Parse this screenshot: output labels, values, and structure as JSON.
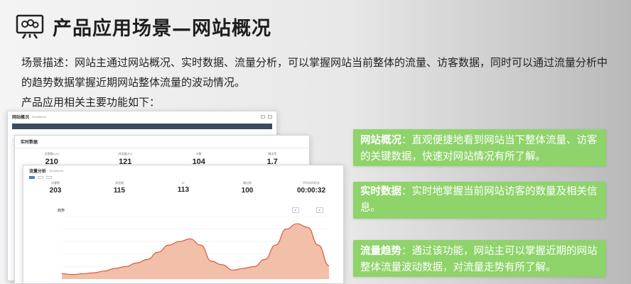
{
  "header": {
    "icon": "presentation-board-icon",
    "title": "产品应用场景—网站概况"
  },
  "description": {
    "text": "场景描述：网站主通过网站概况、实时数据、流量分析，可以掌握网站当前整体的流量、访客数据，同时可以通过流量分析中的趋势数据掌握近期网站整体流量的波动情况。",
    "intro": "产品应用相关主要功能如下："
  },
  "screens": {
    "overview": {
      "title": "网站概况",
      "date": "2016/05/24"
    },
    "realtime": {
      "title": "实时数据",
      "metrics": [
        {
          "label": "访客数(UV)",
          "value": "210"
        },
        {
          "label": "浏览量(PV)",
          "value": "121"
        },
        {
          "label": "IP数",
          "value": "104"
        },
        {
          "label": "跳出率",
          "value": "1.7"
        }
      ]
    },
    "traffic": {
      "title": "流量分析",
      "date": "2016/05/24",
      "metrics": [
        {
          "label": "访客数",
          "value": "203"
        },
        {
          "label": "浏览量",
          "value": "115"
        },
        {
          "label": "IP",
          "value": "113"
        },
        {
          "label": "跳出率",
          "value": "100"
        },
        {
          "label": "平均访问时长",
          "value": "00:00:32"
        }
      ],
      "trend_label": "趋势"
    }
  },
  "features": [
    {
      "name": "网站概况",
      "sep": "：",
      "text": "直观便捷地看到网站当下整体流量、访客的关键数据，快速对网站情况有所了解。"
    },
    {
      "name": "实时数据",
      "sep": "：",
      "text": "实时地掌握当前网站访客的数量及相关信息。"
    },
    {
      "name": "流量趋势",
      "sep": "：",
      "text": "通过该功能，网站主可以掌握近期的网站整体流量波动数据，对流量走势有所了解。"
    }
  ],
  "colors": {
    "green_box": "#8fd36b",
    "chart_fill": "#f0b49a",
    "chart_line": "#d9593a",
    "table_head": "#3b4b60"
  },
  "chart_data": {
    "type": "area",
    "values": [
      6,
      5,
      6,
      7,
      9,
      12,
      14,
      18,
      22,
      30,
      38,
      42,
      45,
      38,
      20,
      16,
      10,
      12,
      14,
      22,
      38,
      56,
      62,
      58,
      38,
      15
    ],
    "ylim": [
      0,
      70
    ]
  }
}
